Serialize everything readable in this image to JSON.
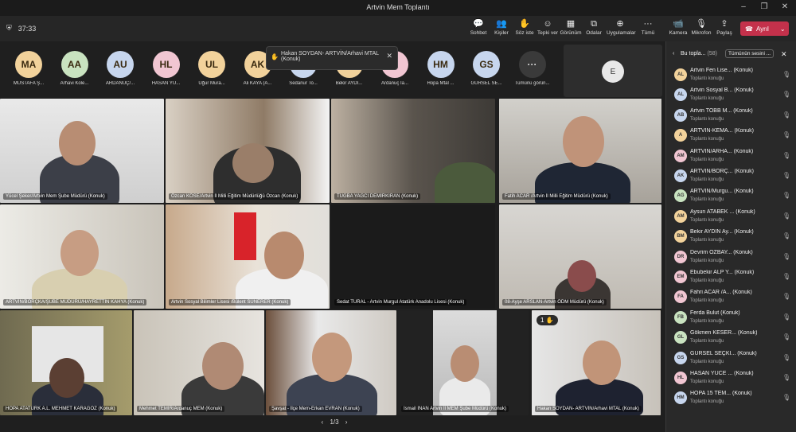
{
  "window": {
    "title": "Artvin Mem Toplantı",
    "minimize": "–",
    "maximize": "❐",
    "close": "✕"
  },
  "toolbar": {
    "timer": "37:33",
    "buttons": [
      {
        "label": "Sohbet",
        "icon": "chat-icon"
      },
      {
        "label": "Kişiler",
        "icon": "people-icon",
        "badge": "58"
      },
      {
        "label": "Söz iste",
        "icon": "raise-hand-icon"
      },
      {
        "label": "Tepki ver",
        "icon": "react-icon"
      },
      {
        "label": "Görünüm",
        "icon": "view-icon"
      },
      {
        "label": "Odalar",
        "icon": "rooms-icon"
      },
      {
        "label": "Uygulamalar",
        "icon": "apps-icon"
      },
      {
        "label": "Tümü",
        "icon": "more-icon"
      },
      {
        "label": "Kamera",
        "icon": "camera-icon"
      },
      {
        "label": "Mikrofon",
        "icon": "mic-icon"
      },
      {
        "label": "Paylaş",
        "icon": "share-icon"
      }
    ],
    "leave": "Ayrıl"
  },
  "strip": {
    "avatars": [
      {
        "initials": "MA",
        "name": "MUSTAFA Ş...",
        "color": "#f2d29b"
      },
      {
        "initials": "AA",
        "name": "Arhavi Kole...",
        "color": "#c9e3c0"
      },
      {
        "initials": "AU",
        "name": "ARDANUÇ/...",
        "color": "#c7d6ee"
      },
      {
        "initials": "HL",
        "name": "HASAN YÜ...",
        "color": "#f1c6d2"
      },
      {
        "initials": "UL",
        "name": "Uğur Mura...",
        "color": "#f2d29b"
      },
      {
        "initials": "AK",
        "name": "Ali KAYA (A...",
        "color": "#f2d29b"
      },
      {
        "initials": "",
        "name": "Sedanur To...",
        "color": "#c7d6ee"
      },
      {
        "initials": "",
        "name": "Bekir AYDI...",
        "color": "#f2d29b"
      },
      {
        "initials": "K",
        "name": "Ardanuç İa...",
        "color": "#f1c6d2"
      },
      {
        "initials": "HM",
        "name": "Hopa Mtal ...",
        "color": "#c7d6ee"
      },
      {
        "initials": "GS",
        "name": "GÜRSEL SE...",
        "color": "#c7d6ee"
      },
      {
        "initials": "···",
        "name": "Tümünü görün...",
        "color": "#3a3a3a"
      }
    ],
    "self_initial": "E"
  },
  "toast": {
    "text_line1": "Hakan SOYDAN- ARTVİN/Arhavi MTAL",
    "text_line2": "(Konuk)"
  },
  "tiles": [
    {
      "label": "Yücel Şeker/Artvin Mem Şube Müdürü (Konuk)"
    },
    {
      "label": "Özcan KÖSE/Artvin İl Milli Eğitim Müdürlüğü Özcan (Konuk)"
    },
    {
      "label": "TUĞBA YAĞCI DEMİRKIRAN (Konuk)"
    },
    {
      "label": "Fatih ACAR /Artvin İl Milli Eğitim Müdürü (Konuk)"
    },
    {
      "label": "ARTVİN/BORÇKA/ŞUBE MÜDÜRÜ/HAYRETTİN KAHYA (Konuk)"
    },
    {
      "label": "Artvin Sosyal Bilimler Lisesi /Bülent SÜNERER (Konuk)"
    },
    {
      "label": "Sedat TURAL - Artvin Murgul Atatürk Anadolu Lisesi (Konuk)"
    },
    {
      "label": "08-Ayşe ARSLAN-Artvin ÖDM Müdürü (Konuk)"
    },
    {
      "label": "HOPA ATATÜRK A.L. MEHMET KARAGÖZ (Konuk)"
    },
    {
      "label": "Mehmet TEMİR/Ardanuç MEM (Konuk)"
    },
    {
      "label": "Şavşat - İlçe Mem-Erkan EVRAN (Konuk)"
    },
    {
      "label": "İsmail İNAN Artvin İl MEM Şube Müdürü (Konuk)"
    },
    {
      "label": "Hakan SOYDAN- ARTVİN/Arhavi MTAL (Konuk)",
      "hand": "1"
    }
  ],
  "pager": "1/3",
  "panel": {
    "title": "Bu topla...",
    "count": "(58)",
    "mute_all": "Tümünün sesini ...",
    "role": "Toplantı konuğu",
    "people": [
      {
        "initials": "AL",
        "name": "Artvin Fen Lise... (Konuk)",
        "color": "#f2d29b"
      },
      {
        "initials": "AL",
        "name": "Artvin Sosyal B... (Konuk)",
        "color": "#c7d6ee"
      },
      {
        "initials": "AB",
        "name": "Artvin TOBB M... (Konuk)",
        "color": "#c7d6ee"
      },
      {
        "initials": "A",
        "name": "ARTVİN-KEMA... (Konuk)",
        "color": "#f2d29b"
      },
      {
        "initials": "AM",
        "name": "ARTVİN/ARHA... (Konuk)",
        "color": "#f1c6d2"
      },
      {
        "initials": "AK",
        "name": "ARTVİN/BORÇ... (Konuk)",
        "color": "#c7d6ee"
      },
      {
        "initials": "AG",
        "name": "ARTVİN/Murgu... (Konuk)",
        "color": "#c9e3c0"
      },
      {
        "initials": "AM",
        "name": "Aysun ATABEK ... (Konuk)",
        "color": "#f2d29b"
      },
      {
        "initials": "BM",
        "name": "Bekir AYDIN Ay... (Konuk)",
        "color": "#f2d29b"
      },
      {
        "initials": "DR",
        "name": "Devrim ÖZBAY... (Konuk)",
        "color": "#f1c6d2"
      },
      {
        "initials": "EM",
        "name": "Ebubekir ALP Y... (Konuk)",
        "color": "#f1c6d2"
      },
      {
        "initials": "FA",
        "name": "Fahri ACAR /A... (Konuk)",
        "color": "#f1c6d2"
      },
      {
        "initials": "FB",
        "name": "Ferda Bulut (Konuk)",
        "color": "#c9e3c0"
      },
      {
        "initials": "GL",
        "name": "Gökmen KESER... (Konuk)",
        "color": "#c9e3c0"
      },
      {
        "initials": "GS",
        "name": "GÜRSEL SEÇKİ... (Konuk)",
        "color": "#c7d6ee"
      },
      {
        "initials": "HL",
        "name": "HASAN YÜCE ... (Konuk)",
        "color": "#f1c6d2"
      },
      {
        "initials": "HM",
        "name": "HOPA 15 TEM... (Konuk)",
        "color": "#c7d6ee"
      }
    ]
  }
}
